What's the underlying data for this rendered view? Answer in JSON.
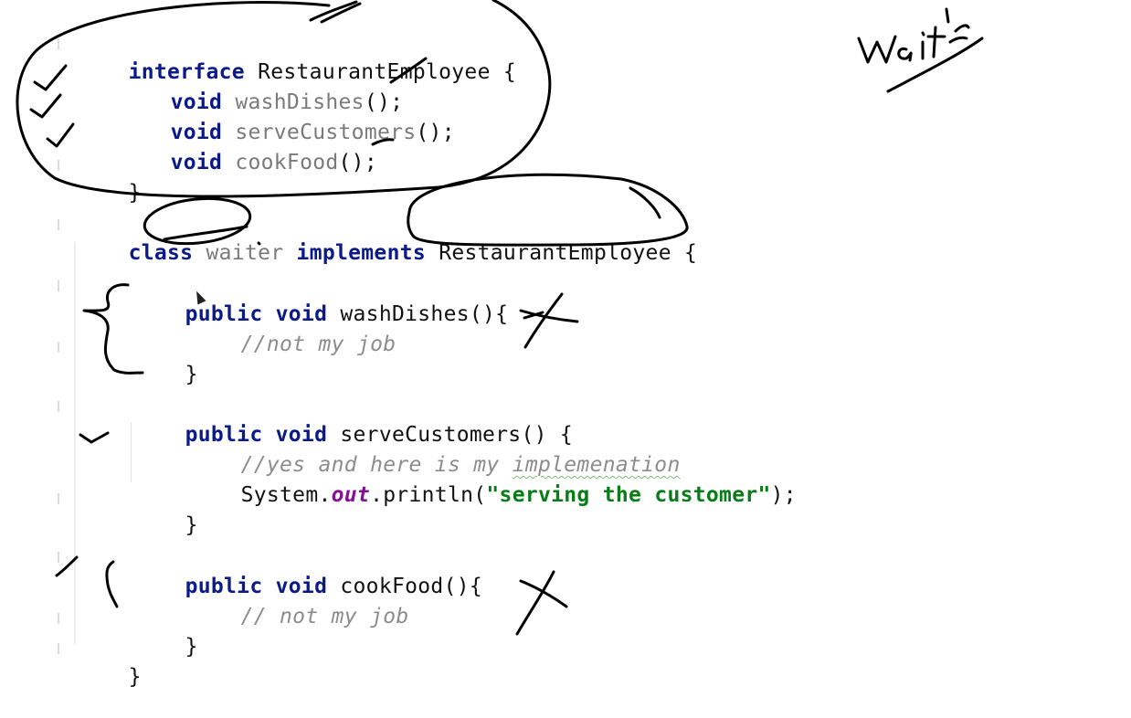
{
  "code": {
    "interface_line": {
      "kw": "interface",
      "name": "RestaurantEmployee",
      "brace": "{"
    },
    "interface_methods": [
      {
        "type": "void",
        "name": "washDishes",
        "suffix": "();"
      },
      {
        "type": "void",
        "name": "serveCustomers",
        "suffix": "();"
      },
      {
        "type": "void",
        "name": "cookFood",
        "suffix": "();"
      }
    ],
    "interface_close": "}",
    "class_line": {
      "kw_class": "class",
      "name": "waiter",
      "kw_implements": "implements",
      "iface": "RestaurantEmployee",
      "brace": "{"
    },
    "methods": [
      {
        "kw_public": "public",
        "kw_void": "void",
        "signature": "washDishes(){",
        "comment": "//not my job",
        "close": "}"
      },
      {
        "kw_public": "public",
        "kw_void": "void",
        "signature": "serveCustomers() {",
        "comment_prefix": "//yes and here is my ",
        "comment_typo": "implemenation",
        "stmt_object": "System.",
        "stmt_field": "out",
        "stmt_call": ".println(",
        "stmt_string": "\"serving the customer\"",
        "stmt_end": ");",
        "close": "}"
      },
      {
        "kw_public": "public",
        "kw_void": "void",
        "signature": "cookFood(){",
        "comment": "// not my job",
        "close": "}"
      }
    ],
    "class_close": "}"
  },
  "annotations": {
    "handwritten_note": "waiter"
  }
}
